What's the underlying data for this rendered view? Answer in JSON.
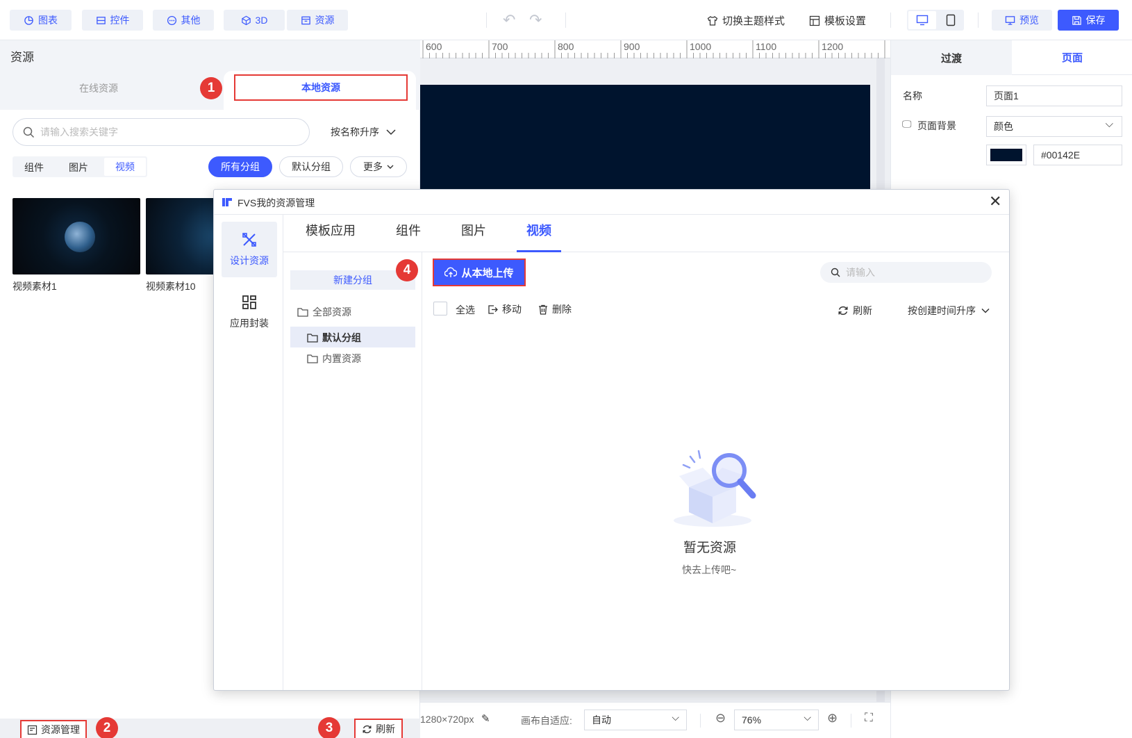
{
  "toolbar": {
    "items": [
      {
        "label": "图表",
        "icon": "chart-icon"
      },
      {
        "label": "控件",
        "icon": "widget-icon"
      },
      {
        "label": "其他",
        "icon": "more-dots-icon"
      },
      {
        "label": "3D",
        "icon": "cube-icon"
      },
      {
        "label": "资源",
        "icon": "resource-icon"
      }
    ],
    "theme_label": "切换主题样式",
    "template_label": "模板设置",
    "preview_label": "预览",
    "save_label": "保存"
  },
  "left_panel": {
    "title": "资源",
    "tab_online": "在线资源",
    "tab_local": "本地资源",
    "search_placeholder": "请输入搜索关键字",
    "sort_label": "按名称升序",
    "type_tabs": [
      "组件",
      "图片",
      "视频"
    ],
    "active_type": "视频",
    "groups": [
      "所有分组",
      "默认分组",
      "更多"
    ],
    "videos": [
      "视频素材1",
      "视频素材10"
    ],
    "manage_label": "资源管理",
    "refresh_label": "刷新"
  },
  "ruler": {
    "ticks": [
      "600",
      "700",
      "800",
      "900",
      "1000",
      "1100",
      "1200"
    ]
  },
  "right_panel": {
    "tabs": [
      "过渡",
      "页面"
    ],
    "name_label": "名称",
    "name_value": "页面1",
    "bg_label": "页面背景",
    "bg_type": "颜色",
    "bg_color": "#00142E"
  },
  "bottom_bar": {
    "size_label": "1280×720px",
    "fit_label": "画布自适应:",
    "fit_value": "自动",
    "zoom": "76%"
  },
  "modal": {
    "title": "FVS我的资源管理",
    "side_items": [
      "设计资源",
      "应用封装"
    ],
    "tabs": [
      "模板应用",
      "组件",
      "图片",
      "视频"
    ],
    "active_tab": "视频",
    "new_group": "新建分组",
    "tree": [
      "全部资源",
      "默认分组",
      "内置资源"
    ],
    "upload_label": "从本地上传",
    "search_placeholder": "请输入",
    "actions": [
      "全选",
      "移动",
      "删除"
    ],
    "refresh_label": "刷新",
    "sort_label": "按创建时间升序",
    "empty_title": "暂无资源",
    "empty_subtitle": "快去上传吧~"
  },
  "badges": [
    "1",
    "2",
    "3",
    "4"
  ],
  "colors": {
    "accent": "#3d5afe",
    "marker": "#e53935",
    "canvas_bg": "#00142E"
  }
}
